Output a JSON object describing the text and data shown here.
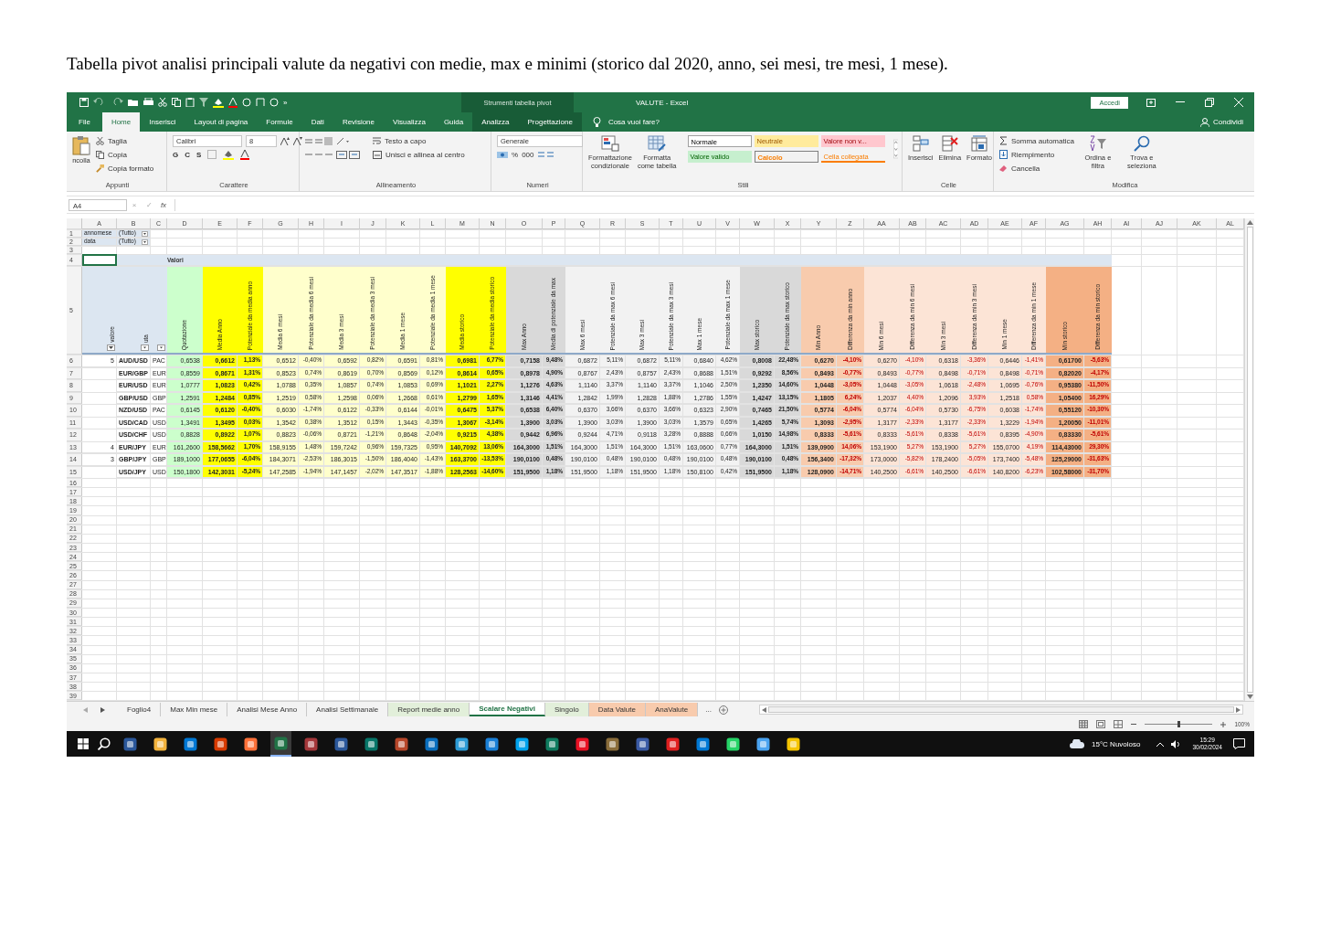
{
  "caption": "Tabella pivot analisi principali valute da negativi con medie, max e minimi (storico dal 2020, anno, sei mesi, tre mesi, 1 mese).",
  "excel": {
    "title_bar": {
      "more": "»",
      "context_tab": "Strumenti tabella pivot",
      "title": "VALUTE - Excel",
      "sign_in": "Accedi"
    },
    "ribbon_tabs": [
      {
        "label": "File",
        "selected": false
      },
      {
        "label": "Home",
        "selected": true
      },
      {
        "label": "Inserisci",
        "selected": false
      },
      {
        "label": "Layout di pagina",
        "selected": false
      },
      {
        "label": "Formule",
        "selected": false
      },
      {
        "label": "Dati",
        "selected": false
      },
      {
        "label": "Revisione",
        "selected": false
      },
      {
        "label": "Visualizza",
        "selected": false
      },
      {
        "label": "Guida",
        "selected": false
      },
      {
        "label": "Analizza",
        "selected": false,
        "kind": "context"
      },
      {
        "label": "Progettazione",
        "selected": false,
        "kind": "context"
      }
    ],
    "tell_me": "Cosa vuoi fare?",
    "share": "Condividi",
    "ribbon": {
      "clipboard": {
        "paste": "ncolla",
        "cut": "Taglia",
        "copy": "Copia",
        "format_painter": "Copia formato",
        "group": "Appunti"
      },
      "font": {
        "name": "Calibri",
        "size": "8",
        "bold": "G",
        "italic": "C",
        "underline": "S",
        "group": "Carattere"
      },
      "alignment": {
        "wrap": "Testo a capo",
        "merge": "Unisci e allinea al centro",
        "group": "Allineamento"
      },
      "number": {
        "format": "Generale",
        "percent": "%",
        "thousands": "000",
        "group": "Numeri"
      },
      "styles": {
        "conditional": "Formattazione condizionale",
        "format_table": "Formatta come tabella",
        "group": "Stili",
        "cells": [
          {
            "label": "Normale",
            "kind": "normal"
          },
          {
            "label": "Neutrale",
            "kind": "neutral"
          },
          {
            "label": "Valore non v...",
            "kind": "bad"
          },
          {
            "label": "Valore valido",
            "kind": "good"
          },
          {
            "label": "Calcolo",
            "kind": "calc"
          },
          {
            "label": "Cella collegata",
            "kind": "linked"
          }
        ]
      },
      "cells": {
        "insert": "Inserisci",
        "delete": "Elimina",
        "format": "Formato",
        "group": "Celle"
      },
      "editing": {
        "autosum": "Somma automatica",
        "fill": "Riempimento",
        "clear": "Cancella",
        "sort": "Ordina e filtra",
        "find": "Trova e seleziona",
        "group": "Modifica"
      }
    },
    "name_box": "A4",
    "formula_buttons": [
      "×",
      "✓",
      "fx"
    ],
    "column_letters": [
      "A",
      "B",
      "C",
      "D",
      "E",
      "F",
      "G",
      "H",
      "I",
      "J",
      "K",
      "L",
      "M",
      "N",
      "O",
      "P",
      "Q",
      "R",
      "S",
      "T",
      "U",
      "V",
      "W",
      "X",
      "Y",
      "Z",
      "AA",
      "AB",
      "AC",
      "AD",
      "AE",
      "AF",
      "AG",
      "AH",
      "AI",
      "AJ",
      "AK",
      "AL"
    ],
    "row_numbers": [
      "1",
      "2",
      "3",
      "4",
      "5",
      "6",
      "7",
      "8",
      "9",
      "10",
      "11",
      "12",
      "13",
      "14",
      "15",
      "16",
      "17",
      "18",
      "19",
      "20",
      "21",
      "22",
      "23",
      "24",
      "25",
      "26",
      "27",
      "28",
      "29",
      "30",
      "31",
      "32",
      "33",
      "34",
      "35",
      "36",
      "37",
      "38",
      "39"
    ],
    "filters": [
      {
        "field": "annomese",
        "value": "(Tutto)"
      },
      {
        "field": "data",
        "value": "(Tutto)"
      }
    ],
    "values_label": "Valori",
    "row_headers": [
      "valore",
      "uta"
    ],
    "columns": [
      {
        "header": "Quotazione",
        "color": "#ccffcc",
        "kind": "value",
        "bold": false
      },
      {
        "header": "Media Anno",
        "color": "#ffff00",
        "kind": "value",
        "bold": true
      },
      {
        "header": "Potenziale da media anno",
        "color": "#ffff00",
        "kind": "percent",
        "bold": true
      },
      {
        "header": "Media 6 mesi",
        "color": "#ffffcc",
        "kind": "value",
        "bold": false
      },
      {
        "header": "Potenziale da media 6 mesi",
        "color": "#ffffcc",
        "kind": "percent",
        "bold": false
      },
      {
        "header": "Media 3 mesi",
        "color": "#ffffcc",
        "kind": "value",
        "bold": false
      },
      {
        "header": "Potenziale da media 3 mesi",
        "color": "#ffffcc",
        "kind": "percent",
        "bold": false
      },
      {
        "header": "Media 1 mese",
        "color": "#ffffcc",
        "kind": "value",
        "bold": false
      },
      {
        "header": "Potenziale da media 1 mese",
        "color": "#ffffcc",
        "kind": "percent",
        "bold": false
      },
      {
        "header": "Media storico",
        "color": "#ffff00",
        "kind": "value",
        "bold": true
      },
      {
        "header": "Potenziale da media storico",
        "color": "#ffff00",
        "kind": "percent",
        "bold": true
      },
      {
        "header": "Max Anno",
        "color": "#d9d9d9",
        "kind": "value",
        "bold": true
      },
      {
        "header": "Media di potenziale da max",
        "color": "#d9d9d9",
        "kind": "percent",
        "bold": true
      },
      {
        "header": "Max 6 mesi",
        "color": "#f2f2f2",
        "kind": "value",
        "bold": false
      },
      {
        "header": "Potenziale da max 6 mesi",
        "color": "#f2f2f2",
        "kind": "percent",
        "bold": false
      },
      {
        "header": "Max 3 mesi",
        "color": "#f2f2f2",
        "kind": "value",
        "bold": false
      },
      {
        "header": "Potenziale da max 3 mesi",
        "color": "#f2f2f2",
        "kind": "percent",
        "bold": false
      },
      {
        "header": "Max 1 mese",
        "color": "#f2f2f2",
        "kind": "value",
        "bold": false
      },
      {
        "header": "Potenziale da max 1 mese",
        "color": "#f2f2f2",
        "kind": "percent",
        "bold": false
      },
      {
        "header": "Max storico",
        "color": "#d9d9d9",
        "kind": "value",
        "bold": true
      },
      {
        "header": "Potenziale da max storico",
        "color": "#d9d9d9",
        "kind": "percent",
        "bold": true
      },
      {
        "header": "Min Anno",
        "color": "#f8cbad",
        "kind": "value",
        "bold": true
      },
      {
        "header": "Differenza da min anno",
        "color": "#f8cbad",
        "kind": "difference",
        "bold": true
      },
      {
        "header": "Min 6 mesi",
        "color": "#fce4d6",
        "kind": "value",
        "bold": false
      },
      {
        "header": "Differenza da min 6 mesi",
        "color": "#fce4d6",
        "kind": "difference",
        "bold": false
      },
      {
        "header": "Min 3 mesi",
        "color": "#fce4d6",
        "kind": "value",
        "bold": false
      },
      {
        "header": "Differenza da min 3 mesi",
        "color": "#fce4d6",
        "kind": "difference",
        "bold": false
      },
      {
        "header": "Min 1 mese",
        "color": "#fce4d6",
        "kind": "value",
        "bold": false
      },
      {
        "header": "Differenza da min 1 mese",
        "color": "#fce4d6",
        "kind": "difference",
        "bold": false
      },
      {
        "header": "Min storico",
        "color": "#f4b084",
        "kind": "value",
        "bold": true
      },
      {
        "header": "Differenza da min storico",
        "color": "#f4b084",
        "kind": "difference",
        "bold": true
      }
    ],
    "rows": [
      {
        "group": "5",
        "pair": "AUD/USD",
        "currency": "PAC",
        "values": [
          "0,6538",
          "0,6612",
          "1,13%",
          "0,6512",
          "-0,40%",
          "0,6592",
          "0,82%",
          "0,6591",
          "0,81%",
          "0,6981",
          "6,77%",
          "0,7158",
          "9,48%",
          "0,6872",
          "5,11%",
          "0,6872",
          "5,11%",
          "0,6840",
          "4,62%",
          "0,8008",
          "22,48%",
          "0,6270",
          "-4,10%",
          "0,6270",
          "-4,10%",
          "0,6318",
          "-3,36%",
          "0,6446",
          "-1,41%",
          "0,61700",
          "-5,63%"
        ]
      },
      {
        "pair": "EUR/GBP",
        "currency": "EUR",
        "values": [
          "0,8559",
          "0,8671",
          "1,31%",
          "0,8523",
          "0,74%",
          "0,8619",
          "0,70%",
          "0,8569",
          "0,12%",
          "0,8614",
          "0,65%",
          "0,8978",
          "4,90%",
          "0,8767",
          "2,43%",
          "0,8757",
          "2,43%",
          "0,8688",
          "1,51%",
          "0,9292",
          "8,56%",
          "0,8493",
          "-0,77%",
          "0,8493",
          "-0,77%",
          "0,8498",
          "-0,71%",
          "0,8498",
          "-0,71%",
          "0,82020",
          "-4,17%"
        ]
      },
      {
        "pair": "EUR/USD",
        "currency": "EUR",
        "values": [
          "1,0777",
          "1,0823",
          "0,42%",
          "1,0788",
          "0,35%",
          "1,0857",
          "0,74%",
          "1,0853",
          "0,69%",
          "1,1021",
          "2,27%",
          "1,1276",
          "4,63%",
          "1,1140",
          "3,37%",
          "1,1140",
          "3,37%",
          "1,1046",
          "2,50%",
          "1,2350",
          "14,60%",
          "1,0448",
          "-3,05%",
          "1,0448",
          "-3,05%",
          "1,0618",
          "-2,48%",
          "1,0695",
          "-0,76%",
          "0,95380",
          "-11,50%"
        ]
      },
      {
        "pair": "GBP/USD",
        "currency": "GBP",
        "values": [
          "1,2591",
          "1,2484",
          "0,85%",
          "1,2519",
          "0,58%",
          "1,2598",
          "0,06%",
          "1,2668",
          "0,61%",
          "1,2799",
          "1,65%",
          "1,3146",
          "4,41%",
          "1,2842",
          "1,99%",
          "1,2828",
          "1,88%",
          "1,2786",
          "1,55%",
          "1,4247",
          "13,15%",
          "1,1805",
          "6,24%",
          "1,2037",
          "4,40%",
          "1,2096",
          "3,93%",
          "1,2518",
          "0,58%",
          "1,05400",
          "16,29%"
        ]
      },
      {
        "pair": "NZD/USD",
        "currency": "PAC",
        "values": [
          "0,6145",
          "0,6120",
          "-0,40%",
          "0,6030",
          "-1,74%",
          "0,6122",
          "-0,33%",
          "0,6144",
          "-0,01%",
          "0,6475",
          "5,37%",
          "0,6538",
          "6,40%",
          "0,6370",
          "3,66%",
          "0,6370",
          "3,66%",
          "0,6323",
          "2,90%",
          "0,7465",
          "21,50%",
          "0,5774",
          "-6,04%",
          "0,5774",
          "-6,04%",
          "0,5730",
          "-6,75%",
          "0,6038",
          "-1,74%",
          "0,55120",
          "-10,30%"
        ]
      },
      {
        "pair": "USD/CAD",
        "currency": "USD",
        "values": [
          "1,3491",
          "1,3495",
          "0,03%",
          "1,3542",
          "0,38%",
          "1,3512",
          "0,15%",
          "1,3443",
          "-0,35%",
          "1,3067",
          "-3,14%",
          "1,3900",
          "3,03%",
          "1,3900",
          "3,03%",
          "1,3900",
          "3,03%",
          "1,3579",
          "0,65%",
          "1,4265",
          "5,74%",
          "1,3093",
          "-2,95%",
          "1,3177",
          "-2,33%",
          "1,3177",
          "-2,33%",
          "1,3229",
          "-1,94%",
          "1,20050",
          "-11,01%"
        ]
      },
      {
        "pair": "USD/CHF",
        "currency": "USD",
        "values": [
          "0,8828",
          "0,8922",
          "1,07%",
          "0,8823",
          "-0,06%",
          "0,8721",
          "-1,21%",
          "0,8648",
          "-2,04%",
          "0,9215",
          "4,38%",
          "0,9442",
          "6,96%",
          "0,9244",
          "4,71%",
          "0,9118",
          "3,28%",
          "0,8888",
          "0,66%",
          "1,0150",
          "14,98%",
          "0,8333",
          "-5,61%",
          "0,8333",
          "-5,61%",
          "0,8338",
          "-5,61%",
          "0,8395",
          "-4,90%",
          "0,83330",
          "-5,61%"
        ]
      },
      {
        "group": "4",
        "pair": "EUR/JPY",
        "currency": "EUR",
        "values": [
          "161,2600",
          "158,5662",
          "1,70%",
          "158,9155",
          "1,48%",
          "159,7242",
          "0,96%",
          "159,7325",
          "0,95%",
          "140,7092",
          "13,06%",
          "164,3000",
          "1,51%",
          "164,3000",
          "1,51%",
          "164,3000",
          "1,51%",
          "163,0600",
          "0,77%",
          "164,3000",
          "1,51%",
          "139,0900",
          "14,06%",
          "153,1900",
          "5,27%",
          "153,1900",
          "5,27%",
          "155,0700",
          "4,19%",
          "114,43000",
          "29,30%"
        ]
      },
      {
        "group": "3",
        "pair": "GBP/JPY",
        "currency": "GBP",
        "values": [
          "189,1000",
          "177,0655",
          "-6,04%",
          "184,3071",
          "-2,53%",
          "186,3015",
          "-1,50%",
          "186,4040",
          "-1,43%",
          "163,3700",
          "-13,53%",
          "190,0100",
          "0,48%",
          "190,0100",
          "0,48%",
          "190,0100",
          "0,48%",
          "190,0100",
          "0,48%",
          "190,0100",
          "0,48%",
          "156,3400",
          "-17,32%",
          "173,0000",
          "-5,82%",
          "178,2400",
          "-5,05%",
          "173,7400",
          "-5,48%",
          "125,29000",
          "-31,63%"
        ]
      },
      {
        "pair": "USD/JPY",
        "currency": "USD",
        "values": [
          "150,1800",
          "142,3031",
          "-5,24%",
          "147,2585",
          "-1,94%",
          "147,1457",
          "-2,02%",
          "147,3517",
          "-1,88%",
          "128,2563",
          "-14,60%",
          "151,9500",
          "1,18%",
          "151,9500",
          "1,18%",
          "151,9500",
          "1,18%",
          "150,8100",
          "0,42%",
          "151,9500",
          "1,18%",
          "128,0900",
          "-14,71%",
          "140,2500",
          "-6,61%",
          "140,2500",
          "-6,61%",
          "140,8200",
          "-6,23%",
          "102,58000",
          "-31,70%"
        ]
      }
    ],
    "sheet_tabs": [
      {
        "label": "Foglio4",
        "selected": false
      },
      {
        "label": "Max Min mese",
        "selected": false
      },
      {
        "label": "Analisi Mese Anno",
        "selected": false
      },
      {
        "label": "Analisi Settimanale",
        "selected": false
      },
      {
        "label": "Report medie anno",
        "selected": false,
        "color": "#e2efda"
      },
      {
        "label": "Scalare Negativi",
        "selected": true
      },
      {
        "label": "Singolo",
        "selected": false,
        "color": "#e2efda"
      },
      {
        "label": "Data Valute",
        "selected": false,
        "color": "#f8cbad"
      },
      {
        "label": "AnaValute",
        "selected": false,
        "color": "#f8cbad"
      }
    ],
    "more_tabs": "...",
    "zoom_slider": {
      "level": 0.5
    },
    "zoom": "100%",
    "taskbar": {
      "weather": "15°C Nuvoloso",
      "time": "15:29",
      "date": "30/02/2024"
    }
  }
}
